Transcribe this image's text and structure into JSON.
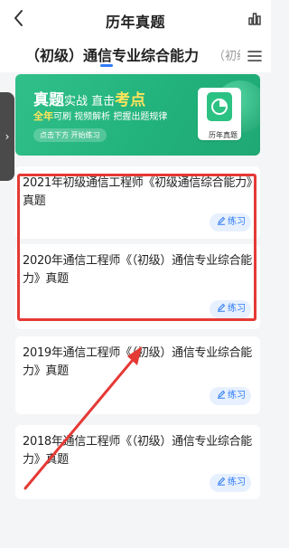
{
  "header": {
    "title": "历年真题",
    "back_glyph": "‹"
  },
  "tabs": {
    "active": "（初级）通信专业综合能力",
    "next": "（初级"
  },
  "side_handle": {
    "glyph": "›"
  },
  "banner": {
    "head_a": "真题",
    "head_b": "实战 直击",
    "head_c": "考点",
    "sub_a": "全年",
    "sub_b": "可刷 视频解析 把握出题规律",
    "cta": "点击下方 开始练习",
    "book_label": "历年真题"
  },
  "papers": [
    {
      "title": "2021年初级通信工程师《初级通信综合能力》真题",
      "action": "练习"
    },
    {
      "title": "2020年通信工程师《（初级）通信专业综合能力》真题",
      "action": "练习"
    },
    {
      "title": "2019年通信工程师《（初级）通信专业综合能力》真题",
      "action": "练习"
    },
    {
      "title": "2018年通信工程师《（初级）通信专业综合能力》真题",
      "action": "练习"
    }
  ],
  "colors": {
    "accent": "#2f7cf6",
    "banner_green": "#22b27c",
    "annotation_red": "#e53935"
  }
}
